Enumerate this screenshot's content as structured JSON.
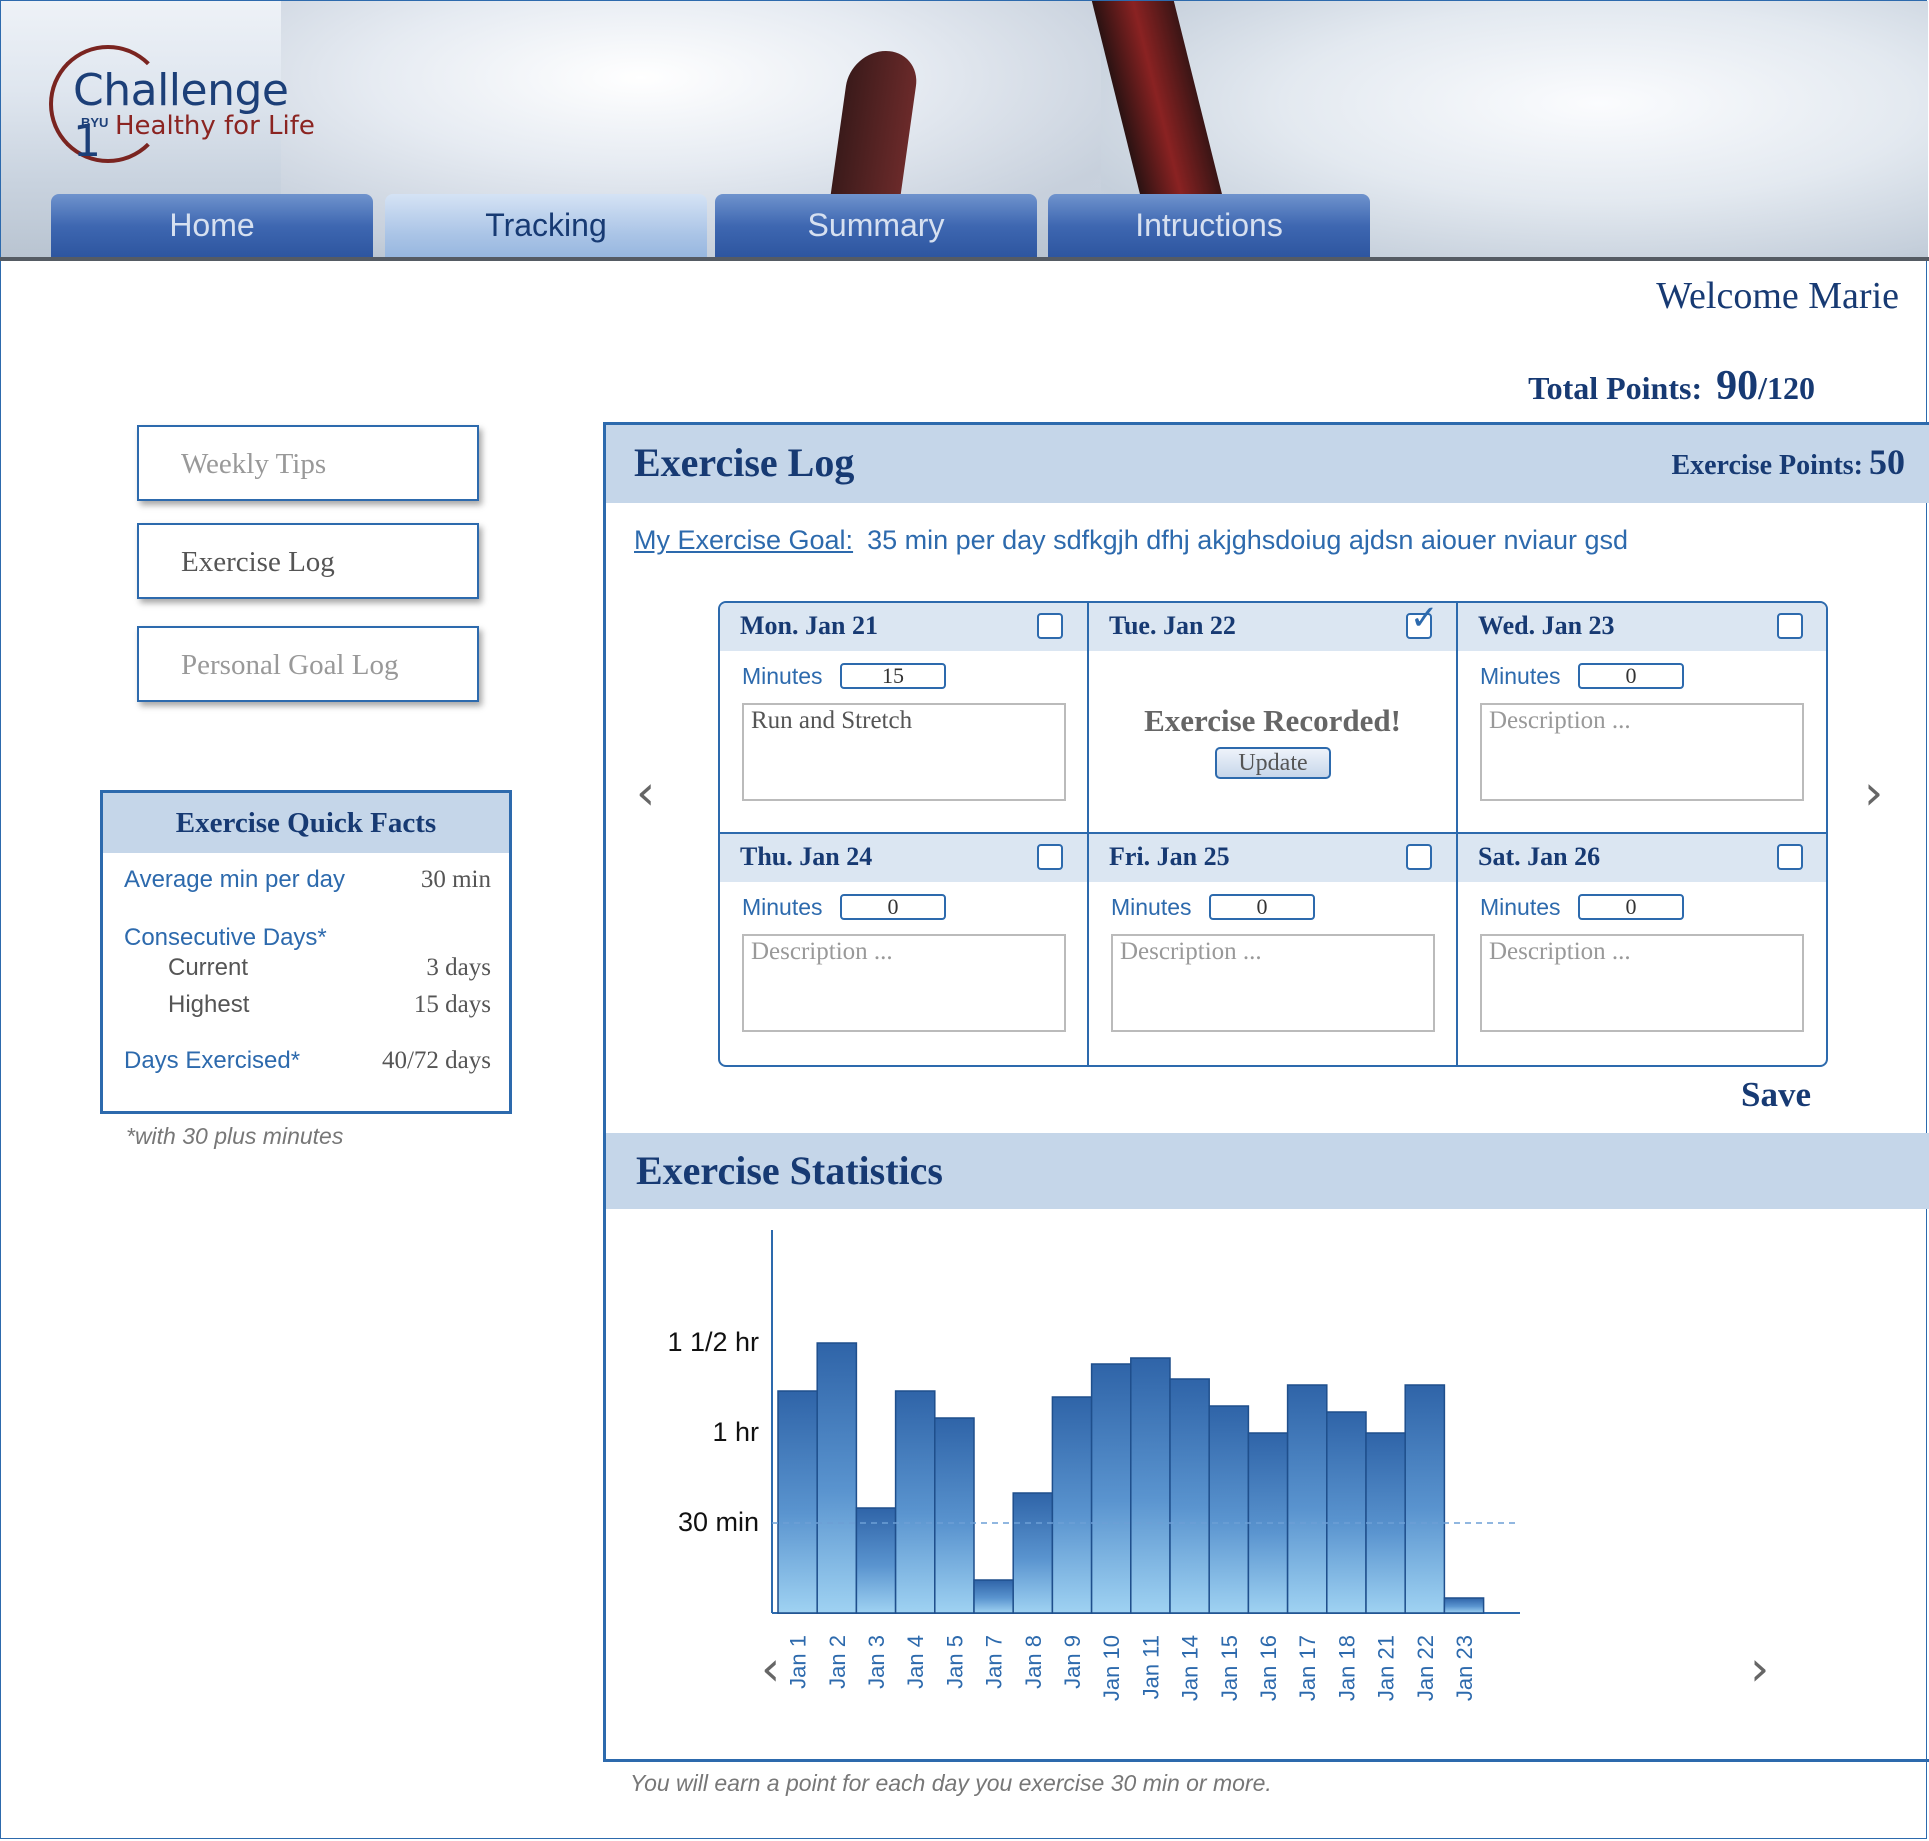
{
  "header": {
    "logo_title": "Challenge 1",
    "logo_byu": "BYU",
    "logo_sub": "Healthy for Life",
    "tabs": [
      {
        "label": "Home"
      },
      {
        "label": "Tracking",
        "active": true
      },
      {
        "label": "Summary"
      },
      {
        "label": "Intructions"
      }
    ]
  },
  "welcome": "Welcome Marie",
  "total_points": {
    "label": "Total Points:",
    "value": "90",
    "max": "/120"
  },
  "sidebar": {
    "buttons": [
      {
        "label": "Weekly Tips"
      },
      {
        "label": "Exercise Log",
        "active": true
      },
      {
        "label": "Personal Goal Log"
      }
    ]
  },
  "quick_facts": {
    "title": "Exercise Quick Facts",
    "avg_label": "Average min per day",
    "avg_value": "30 min",
    "consec_label": "Consecutive Days*",
    "current_label": "Current",
    "current_value": "3 days",
    "highest_label": "Highest",
    "highest_value": "15 days",
    "days_label": "Days Exercised*",
    "days_value": "40/72 days",
    "note": "*with 30 plus minutes"
  },
  "exercise_log": {
    "title": "Exercise Log",
    "points_label": "Exercise Points:",
    "points_value": "50",
    "goal_link": "My Exercise Goal:",
    "goal_text": "35 min per day sdfkgjh dfhj akjghsdoiug ajdsn aiouer nviaur gsd",
    "minutes_label": "Minutes",
    "description_placeholder": "Description ...",
    "recorded_text": "Exercise Recorded!",
    "update_label": "Update",
    "save_label": "Save",
    "days": [
      {
        "date": "Mon. Jan 21",
        "checked": false,
        "minutes": "15",
        "description": "Run and Stretch"
      },
      {
        "date": "Tue. Jan 22",
        "checked": true,
        "recorded": true
      },
      {
        "date": "Wed. Jan 23",
        "checked": false,
        "minutes": "0",
        "description": ""
      },
      {
        "date": "Thu. Jan 24",
        "checked": false,
        "minutes": "0",
        "description": ""
      },
      {
        "date": "Fri. Jan 25",
        "checked": false,
        "minutes": "0",
        "description": ""
      },
      {
        "date": "Sat. Jan 26",
        "checked": false,
        "minutes": "0",
        "description": ""
      }
    ]
  },
  "stats": {
    "title": "Exercise Statistics",
    "y_ticks": [
      {
        "label": "30 min",
        "value": 30
      },
      {
        "label": "1 hr",
        "value": 60
      },
      {
        "label": "1 1/2 hr",
        "value": 90
      }
    ],
    "goal_line_minutes": 30
  },
  "chart_data": {
    "type": "bar",
    "title": "",
    "xlabel": "",
    "ylabel": "",
    "ylim": [
      0,
      100
    ],
    "categories": [
      "Jan 1",
      "Jan 2",
      "Jan 3",
      "Jan 4",
      "Jan 5",
      "Jan 7",
      "Jan 8",
      "Jan 9",
      "Jan 10",
      "Jan 11",
      "Jan 14",
      "Jan 15",
      "Jan 16",
      "Jan 17",
      "Jan 18",
      "Jan 21",
      "Jan 22",
      "Jan 23"
    ],
    "values": [
      74,
      90,
      35,
      74,
      65,
      11,
      40,
      72,
      83,
      85,
      78,
      69,
      60,
      76,
      67,
      60,
      76,
      5
    ],
    "y_tick_labels": [
      "30 min",
      "1 hr",
      "1 1/2 hr"
    ],
    "reference_line": 30
  },
  "footer_note": "You will earn a point for each day you exercise 30 min or more."
}
